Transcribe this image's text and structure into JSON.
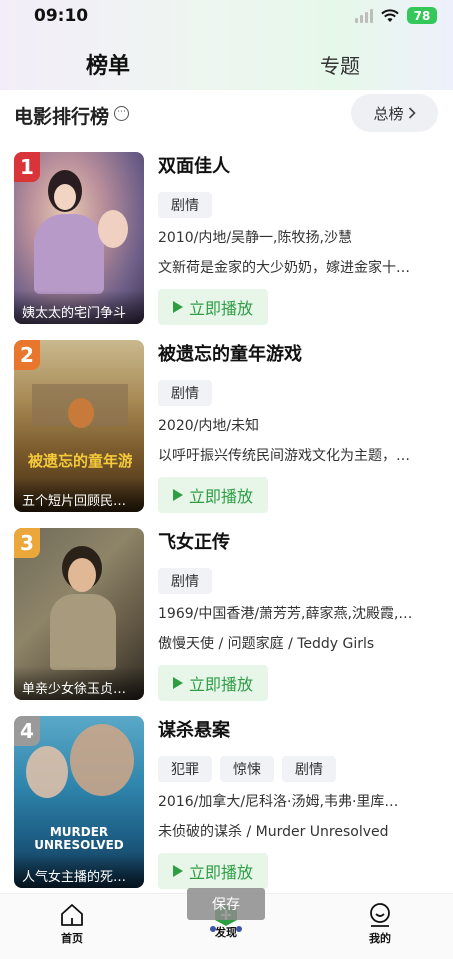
{
  "status": {
    "time": "09:10",
    "battery": "78"
  },
  "tabs": [
    {
      "label": "榜单",
      "active": true
    },
    {
      "label": "专题",
      "active": false
    }
  ],
  "section": {
    "title": "电影排行榜",
    "filter_label": "总榜"
  },
  "items": [
    {
      "rank": "1",
      "title": "双面佳人",
      "tags": [
        "剧情"
      ],
      "meta": "2010/内地/吴静一,陈牧扬,沙慧",
      "desc": "文新荷是金家的大少奶奶，嫁进金家十年…",
      "poster_caption": "姨太太的宅门争斗",
      "play_label": "立即播放"
    },
    {
      "rank": "2",
      "title": "被遗忘的童年游戏",
      "tags": [
        "剧情"
      ],
      "meta": "2020/内地/未知",
      "desc": "以呼吁振兴传统民间游戏文化为主题，…",
      "poster_caption": "五个短片回顾民…",
      "play_label": "立即播放"
    },
    {
      "rank": "3",
      "title": "飞女正传",
      "tags": [
        "剧情"
      ],
      "meta": "1969/中国香港/萧芳芳,薛家燕,沈殿霞,…",
      "desc": "傲慢天使 / 问题家庭 / Teddy Girls",
      "poster_caption": "单亲少女徐玉贞…",
      "play_label": "立即播放"
    },
    {
      "rank": "4",
      "title": "谋杀悬案",
      "tags": [
        "犯罪",
        "惊悚",
        "剧情"
      ],
      "meta": "2016/加拿大/尼科洛·汤姆,韦弗·里库…",
      "desc": "未侦破的谋杀 / Murder Unresolved",
      "poster_caption": "人气女主播的死…",
      "play_label": "立即播放"
    }
  ],
  "bottom_nav": {
    "home": "首页",
    "discover": "发现",
    "mine": "我的"
  },
  "toast": "保存",
  "colors": {
    "accent_green": "#2e9e44",
    "rank_badge": [
      "#d9343a",
      "#e8762c",
      "#eba73a",
      "#9a9a9a"
    ]
  }
}
